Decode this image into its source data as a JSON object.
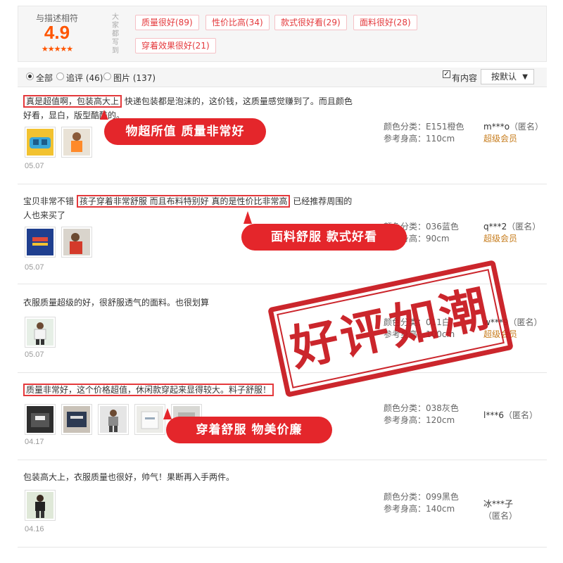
{
  "header": {
    "score_label": "与描述相符",
    "score": "4.9",
    "stars": "★★★★★",
    "vertical_label": [
      "大",
      "家",
      "都",
      "写",
      "到"
    ],
    "tags": [
      "质量很好(89)",
      "性价比高(34)",
      "款式很好看(29)",
      "面料很好(28)",
      "穿着效果很好(21)"
    ]
  },
  "filters": {
    "all": "全部",
    "followup": "追评 (46)",
    "images": "图片 (137)",
    "has_content": "有内容",
    "sort": "按默认",
    "sort_caret": "▼",
    "check_mark": "✓"
  },
  "reviews": [
    {
      "text_boxed": "真是超值啊，包装高大上",
      "text_rest": " 快递包装都是泡沫的，这价钱，这质量感觉赚到了。而且颜色好看，显白，版型酷酷的。",
      "color_label": "颜色分类：E151橙色",
      "height_label": "参考身高：110cm",
      "user": "m***o",
      "anon": "（匿名）",
      "vip": "超级会员",
      "date": "05.07"
    },
    {
      "text_pre": "宝贝非常不错 ",
      "text_boxed": "孩子穿着非常舒服 而且布料特别好 真的是性价比非常高",
      "text_post": " 已经推荐周围的人也来买了",
      "color_label": "颜色分类：036蓝色",
      "height_label": "参考身高：90cm",
      "user": "q***2",
      "anon": "（匿名）",
      "vip": "超级会员",
      "date": "05.07"
    },
    {
      "text": "衣服质量超级的好，很舒服透气的面料。也很划算",
      "color_label": "颜色分类：011白",
      "height_label": "参考身高：100cm",
      "user": "w***9",
      "anon": "（匿名）",
      "vip": "超级会员",
      "date": "05.07"
    },
    {
      "text_boxed": "质量非常好，这个价格超值，休闲款穿起来显得较大。料子舒服！",
      "color_label": "颜色分类：038灰色",
      "height_label": "参考身高：120cm",
      "user": "l***6",
      "anon": "（匿名）",
      "date": "04.17"
    },
    {
      "text": "包装高大上，衣服质量也很好，帅气！果断再入手两件。",
      "color_label": "颜色分类：099黑色",
      "height_label": "参考身高：140cm",
      "user": "冰***子",
      "anon": "（匿名）",
      "date": "04.16"
    }
  ],
  "banners": {
    "b1": "物超所值  质量非常好",
    "b2": "面料舒服 款式好看",
    "b3": "穿着舒服 物美价廉"
  },
  "stamp": "好评如潮",
  "colors": {
    "accent": "#e4393c",
    "orange": "#ff5500",
    "banner": "#e4262b",
    "stamp": "#c8161d"
  }
}
